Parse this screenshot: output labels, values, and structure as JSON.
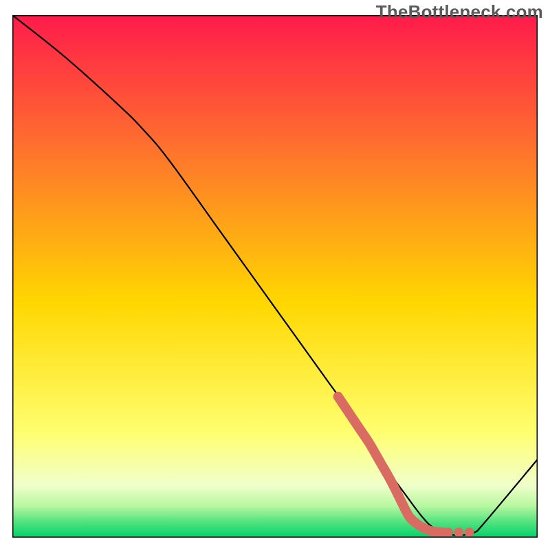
{
  "watermark": "TheBottleneck.com",
  "colors": {
    "gradient_top": "#ff1b4b",
    "gradient_mid_upper": "#ff7a2a",
    "gradient_mid": "#ffd700",
    "gradient_lower": "#ffff70",
    "gradient_pale": "#f0ffca",
    "gradient_green1": "#b6f7a0",
    "gradient_green2": "#54e27f",
    "gradient_green3": "#00d26a",
    "curve": "#000000",
    "highlight": "#d96b63",
    "frame": "#000000"
  },
  "chart_data": {
    "type": "line",
    "title": "",
    "xlabel": "",
    "ylabel": "",
    "xlim": [
      0,
      100
    ],
    "ylim": [
      0,
      100
    ],
    "grid": false,
    "legend": false,
    "series": [
      {
        "name": "bottleneck-curve",
        "x": [
          0,
          10,
          20,
          25,
          30,
          40,
          50,
          60,
          65,
          70,
          75,
          78,
          80,
          82,
          84,
          86,
          88,
          90,
          100
        ],
        "y": [
          100,
          92,
          83,
          78,
          72,
          58,
          44,
          30,
          23,
          15,
          8,
          4,
          2,
          1,
          0.5,
          0.5,
          1,
          3,
          15
        ]
      }
    ],
    "highlight_segment": {
      "name": "optimal-range",
      "x": [
        62,
        64,
        66,
        68,
        70,
        72,
        74,
        75,
        76,
        78,
        80,
        82
      ],
      "y": [
        27,
        24,
        21,
        18,
        14.5,
        11,
        7,
        5,
        3.5,
        2,
        1.2,
        1
      ]
    },
    "highlight_dots": {
      "name": "optimal-dots",
      "points": [
        {
          "x": 83,
          "y": 1
        },
        {
          "x": 85,
          "y": 1
        },
        {
          "x": 87,
          "y": 1
        }
      ]
    }
  }
}
